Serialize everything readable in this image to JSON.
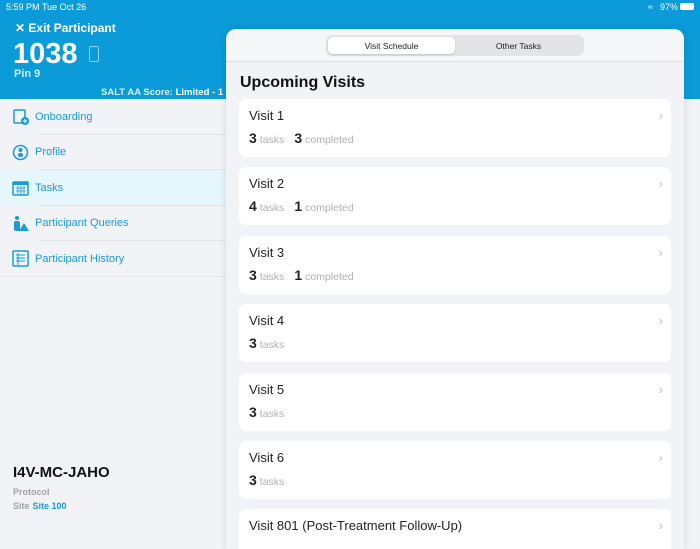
{
  "status": {
    "time": "5:59 PM",
    "date": "Tue Oct 26",
    "wifi": "wifi-icon",
    "battery": "97%"
  },
  "header": {
    "exit_label": "Exit Participant",
    "participant_id": "1038",
    "pin": "Pin 9",
    "salt_label": "SALT AA Score:",
    "salt_value": "Limited - 1"
  },
  "sidebar": {
    "items": [
      {
        "label": "Onboarding",
        "icon": "clipboard-add-icon"
      },
      {
        "label": "Profile",
        "icon": "profile-icon"
      },
      {
        "label": "Tasks",
        "icon": "calendar-icon"
      },
      {
        "label": "Participant Queries",
        "icon": "person-warning-icon"
      },
      {
        "label": "Participant History",
        "icon": "list-icon"
      }
    ],
    "protocol": "I4V-MC-JAHO",
    "protocol_label": "Protocol",
    "site_label": "Site",
    "site_value": "Site 100"
  },
  "tabs": [
    "Visit Schedule",
    "Other Tasks"
  ],
  "section_title": "Upcoming Visits",
  "labels": {
    "tasks": "tasks",
    "completed": "completed"
  },
  "visits": [
    {
      "name": "Visit 1",
      "tasks": "3",
      "completed": "3"
    },
    {
      "name": "Visit 2",
      "tasks": "4",
      "completed": "1"
    },
    {
      "name": "Visit 3",
      "tasks": "3",
      "completed": "1"
    },
    {
      "name": "Visit 4",
      "tasks": "3"
    },
    {
      "name": "Visit 5",
      "tasks": "3"
    },
    {
      "name": "Visit 6",
      "tasks": "3"
    },
    {
      "name": "Visit 801 (Post-Treatment Follow-Up)"
    }
  ]
}
